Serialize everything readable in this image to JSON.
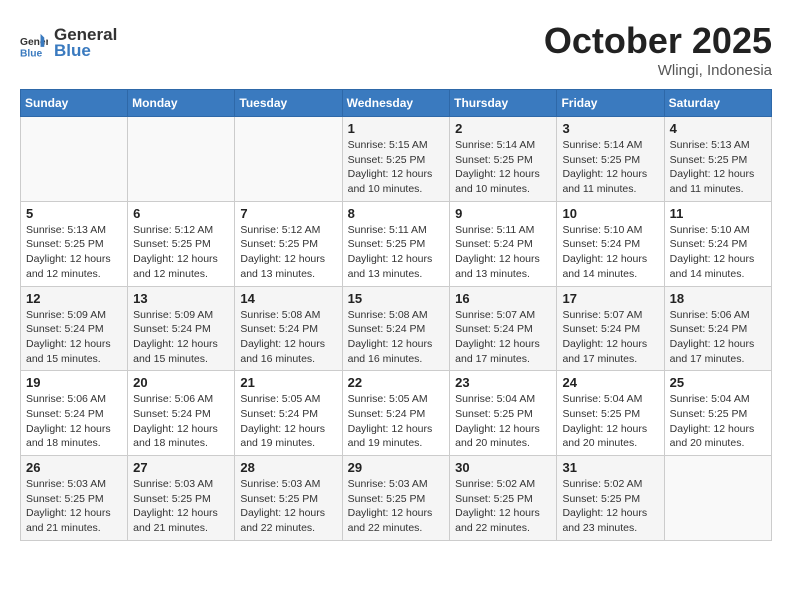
{
  "header": {
    "logo_line1": "General",
    "logo_line2": "Blue",
    "month": "October 2025",
    "location": "Wlingi, Indonesia"
  },
  "weekdays": [
    "Sunday",
    "Monday",
    "Tuesday",
    "Wednesday",
    "Thursday",
    "Friday",
    "Saturday"
  ],
  "weeks": [
    [
      {
        "day": "",
        "info": ""
      },
      {
        "day": "",
        "info": ""
      },
      {
        "day": "",
        "info": ""
      },
      {
        "day": "1",
        "info": "Sunrise: 5:15 AM\nSunset: 5:25 PM\nDaylight: 12 hours\nand 10 minutes."
      },
      {
        "day": "2",
        "info": "Sunrise: 5:14 AM\nSunset: 5:25 PM\nDaylight: 12 hours\nand 10 minutes."
      },
      {
        "day": "3",
        "info": "Sunrise: 5:14 AM\nSunset: 5:25 PM\nDaylight: 12 hours\nand 11 minutes."
      },
      {
        "day": "4",
        "info": "Sunrise: 5:13 AM\nSunset: 5:25 PM\nDaylight: 12 hours\nand 11 minutes."
      }
    ],
    [
      {
        "day": "5",
        "info": "Sunrise: 5:13 AM\nSunset: 5:25 PM\nDaylight: 12 hours\nand 12 minutes."
      },
      {
        "day": "6",
        "info": "Sunrise: 5:12 AM\nSunset: 5:25 PM\nDaylight: 12 hours\nand 12 minutes."
      },
      {
        "day": "7",
        "info": "Sunrise: 5:12 AM\nSunset: 5:25 PM\nDaylight: 12 hours\nand 13 minutes."
      },
      {
        "day": "8",
        "info": "Sunrise: 5:11 AM\nSunset: 5:25 PM\nDaylight: 12 hours\nand 13 minutes."
      },
      {
        "day": "9",
        "info": "Sunrise: 5:11 AM\nSunset: 5:24 PM\nDaylight: 12 hours\nand 13 minutes."
      },
      {
        "day": "10",
        "info": "Sunrise: 5:10 AM\nSunset: 5:24 PM\nDaylight: 12 hours\nand 14 minutes."
      },
      {
        "day": "11",
        "info": "Sunrise: 5:10 AM\nSunset: 5:24 PM\nDaylight: 12 hours\nand 14 minutes."
      }
    ],
    [
      {
        "day": "12",
        "info": "Sunrise: 5:09 AM\nSunset: 5:24 PM\nDaylight: 12 hours\nand 15 minutes."
      },
      {
        "day": "13",
        "info": "Sunrise: 5:09 AM\nSunset: 5:24 PM\nDaylight: 12 hours\nand 15 minutes."
      },
      {
        "day": "14",
        "info": "Sunrise: 5:08 AM\nSunset: 5:24 PM\nDaylight: 12 hours\nand 16 minutes."
      },
      {
        "day": "15",
        "info": "Sunrise: 5:08 AM\nSunset: 5:24 PM\nDaylight: 12 hours\nand 16 minutes."
      },
      {
        "day": "16",
        "info": "Sunrise: 5:07 AM\nSunset: 5:24 PM\nDaylight: 12 hours\nand 17 minutes."
      },
      {
        "day": "17",
        "info": "Sunrise: 5:07 AM\nSunset: 5:24 PM\nDaylight: 12 hours\nand 17 minutes."
      },
      {
        "day": "18",
        "info": "Sunrise: 5:06 AM\nSunset: 5:24 PM\nDaylight: 12 hours\nand 17 minutes."
      }
    ],
    [
      {
        "day": "19",
        "info": "Sunrise: 5:06 AM\nSunset: 5:24 PM\nDaylight: 12 hours\nand 18 minutes."
      },
      {
        "day": "20",
        "info": "Sunrise: 5:06 AM\nSunset: 5:24 PM\nDaylight: 12 hours\nand 18 minutes."
      },
      {
        "day": "21",
        "info": "Sunrise: 5:05 AM\nSunset: 5:24 PM\nDaylight: 12 hours\nand 19 minutes."
      },
      {
        "day": "22",
        "info": "Sunrise: 5:05 AM\nSunset: 5:24 PM\nDaylight: 12 hours\nand 19 minutes."
      },
      {
        "day": "23",
        "info": "Sunrise: 5:04 AM\nSunset: 5:25 PM\nDaylight: 12 hours\nand 20 minutes."
      },
      {
        "day": "24",
        "info": "Sunrise: 5:04 AM\nSunset: 5:25 PM\nDaylight: 12 hours\nand 20 minutes."
      },
      {
        "day": "25",
        "info": "Sunrise: 5:04 AM\nSunset: 5:25 PM\nDaylight: 12 hours\nand 20 minutes."
      }
    ],
    [
      {
        "day": "26",
        "info": "Sunrise: 5:03 AM\nSunset: 5:25 PM\nDaylight: 12 hours\nand 21 minutes."
      },
      {
        "day": "27",
        "info": "Sunrise: 5:03 AM\nSunset: 5:25 PM\nDaylight: 12 hours\nand 21 minutes."
      },
      {
        "day": "28",
        "info": "Sunrise: 5:03 AM\nSunset: 5:25 PM\nDaylight: 12 hours\nand 22 minutes."
      },
      {
        "day": "29",
        "info": "Sunrise: 5:03 AM\nSunset: 5:25 PM\nDaylight: 12 hours\nand 22 minutes."
      },
      {
        "day": "30",
        "info": "Sunrise: 5:02 AM\nSunset: 5:25 PM\nDaylight: 12 hours\nand 22 minutes."
      },
      {
        "day": "31",
        "info": "Sunrise: 5:02 AM\nSunset: 5:25 PM\nDaylight: 12 hours\nand 23 minutes."
      },
      {
        "day": "",
        "info": ""
      }
    ]
  ]
}
